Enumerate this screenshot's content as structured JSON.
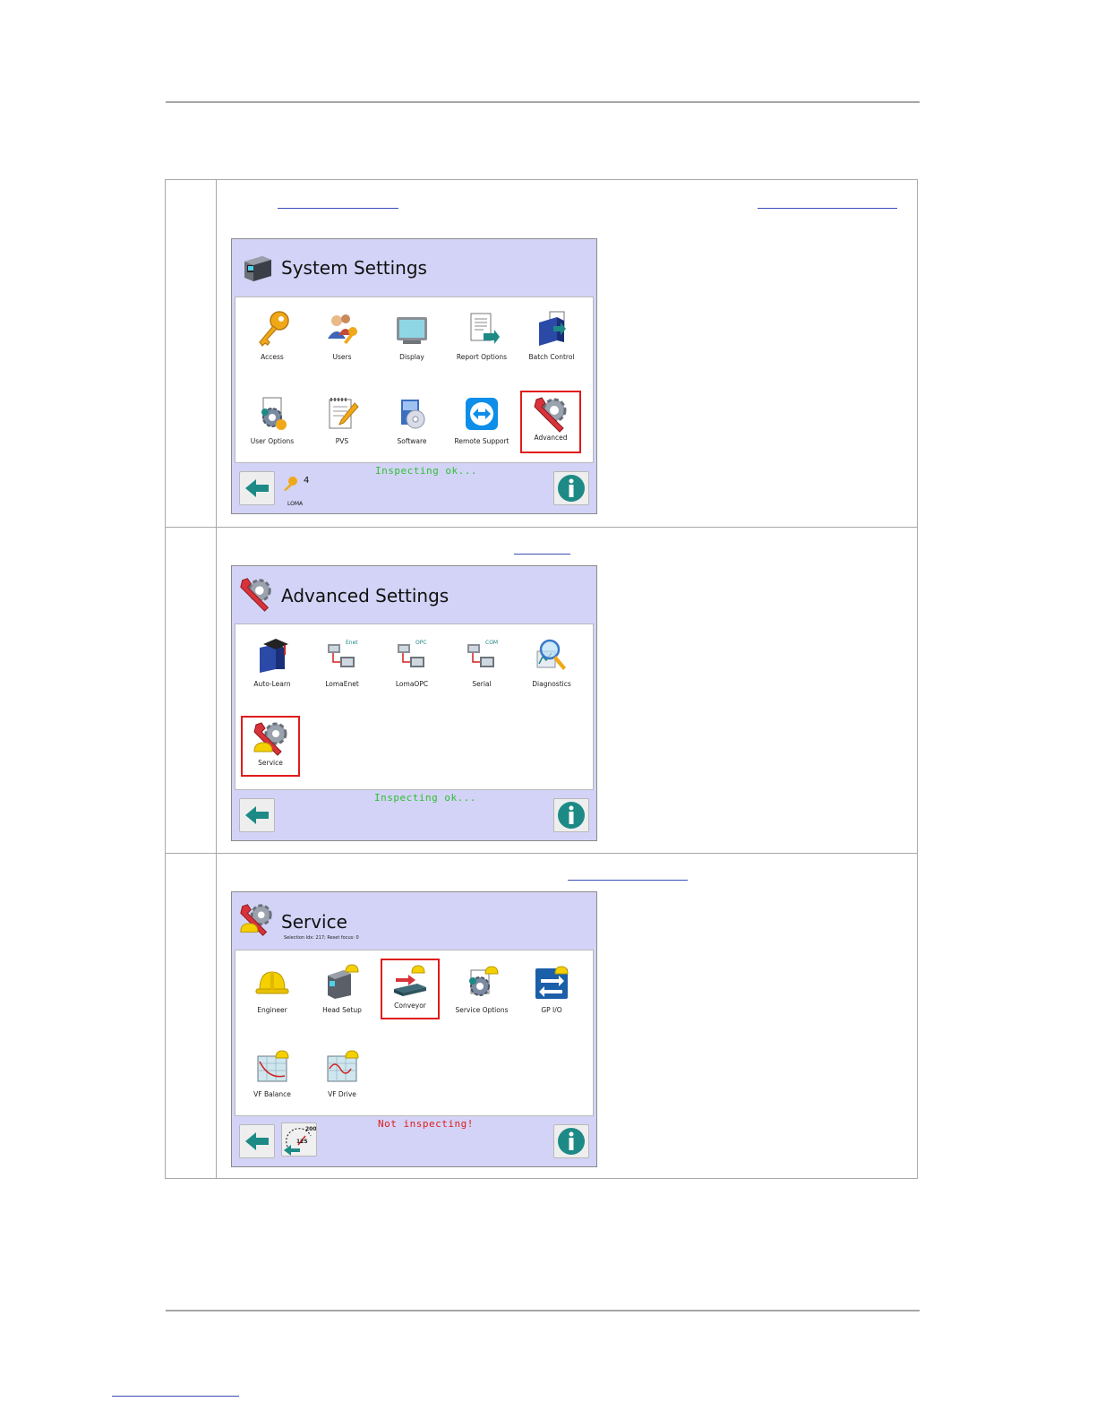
{
  "system_settings": {
    "title": "System Settings",
    "items": [
      {
        "label": "Access",
        "icon": "key-icon"
      },
      {
        "label": "Users",
        "icon": "users-icon"
      },
      {
        "label": "Display",
        "icon": "monitor-icon"
      },
      {
        "label": "Report Options",
        "icon": "report-icon"
      },
      {
        "label": "Batch Control",
        "icon": "batch-icon"
      },
      {
        "label": "User Options",
        "icon": "user-options-icon"
      },
      {
        "label": "PVS",
        "icon": "notepad-icon"
      },
      {
        "label": "Software",
        "icon": "software-icon"
      },
      {
        "label": "Remote Support",
        "icon": "remote-support-icon"
      },
      {
        "label": "Advanced",
        "icon": "wrench-gear-icon"
      }
    ],
    "status": "Inspecting ok...",
    "user_level": "4",
    "user_name": "LOMA"
  },
  "advanced_settings": {
    "title": "Advanced Settings",
    "items": [
      {
        "label": "Auto-Learn",
        "icon": "auto-learn-icon"
      },
      {
        "label": "LomaEnet",
        "icon": "network-icon"
      },
      {
        "label": "LomaOPC",
        "icon": "network-icon"
      },
      {
        "label": "Serial",
        "icon": "network-icon"
      },
      {
        "label": "Diagnostics",
        "icon": "magnifier-icon"
      },
      {
        "label": "Service",
        "icon": "service-icon"
      }
    ],
    "net_tags": [
      "Enet",
      "OPC",
      "COM"
    ],
    "status": "Inspecting ok..."
  },
  "service": {
    "title": "Service",
    "subtitle": "Selection Idx: 217; Reset focus: 0",
    "items": [
      {
        "label": "Engineer",
        "icon": "hardhat-icon"
      },
      {
        "label": "Head Setup",
        "icon": "head-setup-icon"
      },
      {
        "label": "Conveyor",
        "icon": "conveyor-icon"
      },
      {
        "label": "Service Options",
        "icon": "service-options-icon"
      },
      {
        "label": "GP I/O",
        "icon": "gpio-icon"
      },
      {
        "label": "VF Balance",
        "icon": "vf-balance-icon"
      },
      {
        "label": "VF Drive",
        "icon": "vf-drive-icon"
      }
    ],
    "status": "Not inspecting!",
    "speed_value": "125",
    "speed_max": "200"
  },
  "colors": {
    "screen_bg": "#d3d3f7",
    "status_ok": "#2fbf2f",
    "status_bad": "#e01b1b",
    "highlight": "#e01b1b",
    "teal": "#1d8a86"
  }
}
